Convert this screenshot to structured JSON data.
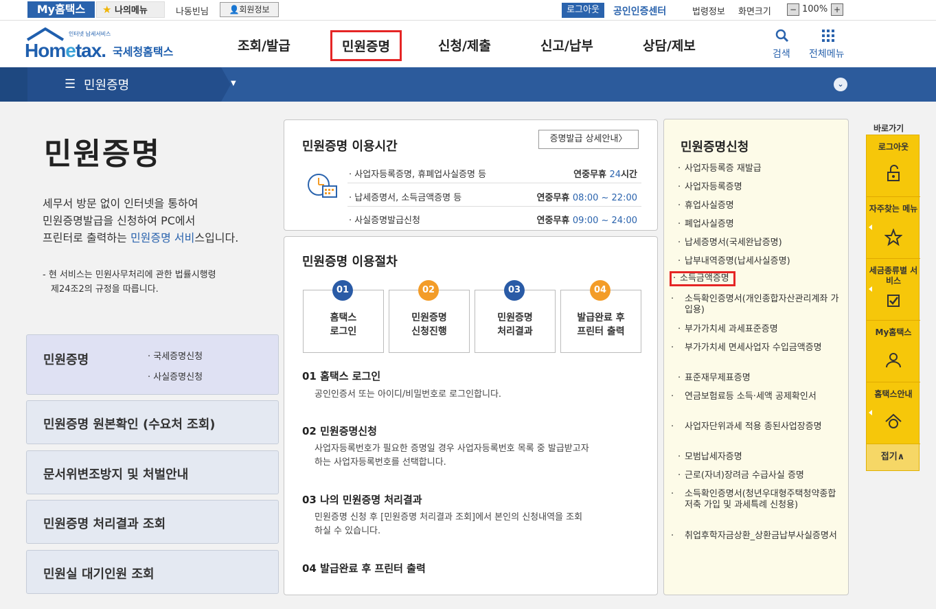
{
  "topbar": {
    "mytax": "My홈택스",
    "mymenu": "나의메뉴",
    "username": "나동빈님",
    "member_info": "회원정보",
    "logout": "로그아웃",
    "cert_center": "공인인증센터",
    "law_info": "법령정보",
    "screen_size": "화면크기",
    "zoom": "100%",
    "zoom_minus": "−",
    "zoom_plus": "+"
  },
  "header": {
    "logo_small": "인터넷 납세서비스",
    "logo_main_a": "Hom",
    "logo_main_e": "e",
    "logo_main_b": "tax.",
    "logo_kr": "국세청홈택스",
    "nav": [
      "조회/발급",
      "민원증명",
      "신청/제출",
      "신고/납부",
      "상담/제보"
    ],
    "search": "검색",
    "allmenu": "전체메뉴"
  },
  "bluebar": {
    "title": "민원증명"
  },
  "left": {
    "title": "민원증명",
    "desc_1": "세무서 방문 없이 인터넷을 통하여",
    "desc_2": "민원증명발급을 신청하여 PC에서",
    "desc_3a": "프린터로 출력하는 ",
    "desc_3b": "민원증명 서비",
    "desc_3c": "스입니다.",
    "note_1": "- 현 서비스는 민원사무처리에 관한 법률시행령",
    "note_2": "제24조2의 규정을 따릅니다.",
    "box1_title": "민원증명",
    "box1_sub1": "· 국세증명신청",
    "box1_sub2": "· 사실증명신청",
    "box2": "민원증명 원본확인 (수요처 조회)",
    "box3": "문서위변조방지 및 처벌안내",
    "box4": "민원증명 처리결과 조회",
    "box5": "민원실 대기인원 조회"
  },
  "hours": {
    "title": "민원증명 이용시간",
    "detail_btn": "증명발급 상세안내〉",
    "rows": [
      {
        "label": "· 사업자등록증명, 휴폐업사실증명 등",
        "prefix": "연중무휴 ",
        "value": "24",
        "suffix": "시간"
      },
      {
        "label": "· 납세증명서, 소득금액증명 등",
        "prefix": "연중무휴 ",
        "value": "08:00 ~ 22:00",
        "suffix": ""
      },
      {
        "label": "· 사실증명발급신청",
        "prefix": "연중무휴 ",
        "value": "09:00 ~ 24:00",
        "suffix": ""
      }
    ]
  },
  "procedure": {
    "title": "민원증명 이용절차",
    "steps": [
      {
        "num": "01",
        "l1": "홈택스",
        "l2": "로그인"
      },
      {
        "num": "02",
        "l1": "민원증명",
        "l2": "신청진행"
      },
      {
        "num": "03",
        "l1": "민원증명",
        "l2": "처리결과"
      },
      {
        "num": "04",
        "l1": "발급완료 후",
        "l2": "프린터 출력"
      }
    ],
    "s1_head": "01 홈택스 로그인",
    "s1_body": "공인인증서 또는 아이디/비밀번호로 로그인합니다.",
    "s2_head": "02 민원증명신청",
    "s2_body_1": "사업자등록번호가 필요한 증명일 경우 사업자등록번호 목록 중 발급받고자",
    "s2_body_2": "하는 사업자등록번호를 선택합니다.",
    "s3_head": "03 나의 민원증명 처리결과",
    "s3_body_1": "민원증명 신청 후 [민원증명 처리결과 조회]에서 본인의 신청내역을 조회",
    "s3_body_2": "하실 수 있습니다.",
    "s4_head": "04 발급완료 후 프린터 출력"
  },
  "apply": {
    "title": "민원증명신청",
    "items": [
      "사업자등록증 재발급",
      "사업자등록증명",
      "휴업사실증명",
      "폐업사실증명",
      "납세증명서(국세완납증명)",
      "납부내역증명(납세사실증명)",
      "소득금액증명",
      "소득확인증명서(개인종합자산관리계좌 가입용)",
      "부가가치세 과세표준증명",
      "부가가치세 면세사업자 수입금액증명",
      "표준재무제표증명",
      "연금보험료등 소득·세액 공제확인서",
      "사업자단위과세 적용 종된사업장증명",
      "모범납세자증명",
      "근로(자녀)장려금 수급사실 증명",
      "소득확인증명서(청년우대형주택청약종합저축 가입 및 과세특례 신청용)",
      "취업후학자금상환_상환금납부사실증명서"
    ]
  },
  "quick": {
    "head": "바로가기",
    "items": [
      "로그아웃",
      "자주찾는 메뉴",
      "세금종류별 서비스",
      "My홈택스",
      "홈택스안내"
    ],
    "close": "접기∧"
  },
  "colors": {
    "brand_blue": "#2a63ad",
    "highlight_red": "#e52525",
    "quick_yellow": "#f6c70a"
  }
}
